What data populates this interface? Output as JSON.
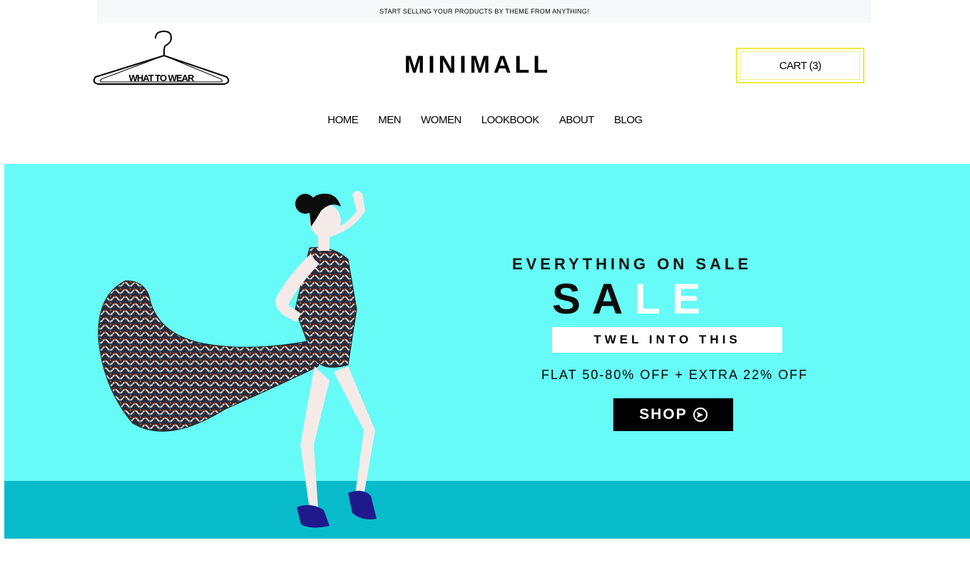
{
  "topbar": {
    "text": "Start selling your products by theme from anything!"
  },
  "logo": {
    "text": "WHAT TO WEAR"
  },
  "brand": {
    "name": "MINIMALL"
  },
  "cart": {
    "label": "CART (3)"
  },
  "nav": {
    "items": [
      {
        "label": "Home"
      },
      {
        "label": "Men"
      },
      {
        "label": "Women"
      },
      {
        "label": "Lookbook"
      },
      {
        "label": "About"
      },
      {
        "label": "Blog"
      }
    ]
  },
  "hero": {
    "headline": "EVERYTHING ON SALE",
    "sale_dark": "SA",
    "sale_light": "LE",
    "tagline": "TWEL INTO THIS",
    "offer": "FLAT 50-80% OFF + EXTRA 22% OFF",
    "shop_label": "SHOP",
    "shop_icon": "arrow-right-circle-icon"
  },
  "colors": {
    "hero_bg": "#66fbf7",
    "hero_floor": "#08bbcb",
    "cart_border": "#ecec3a"
  }
}
